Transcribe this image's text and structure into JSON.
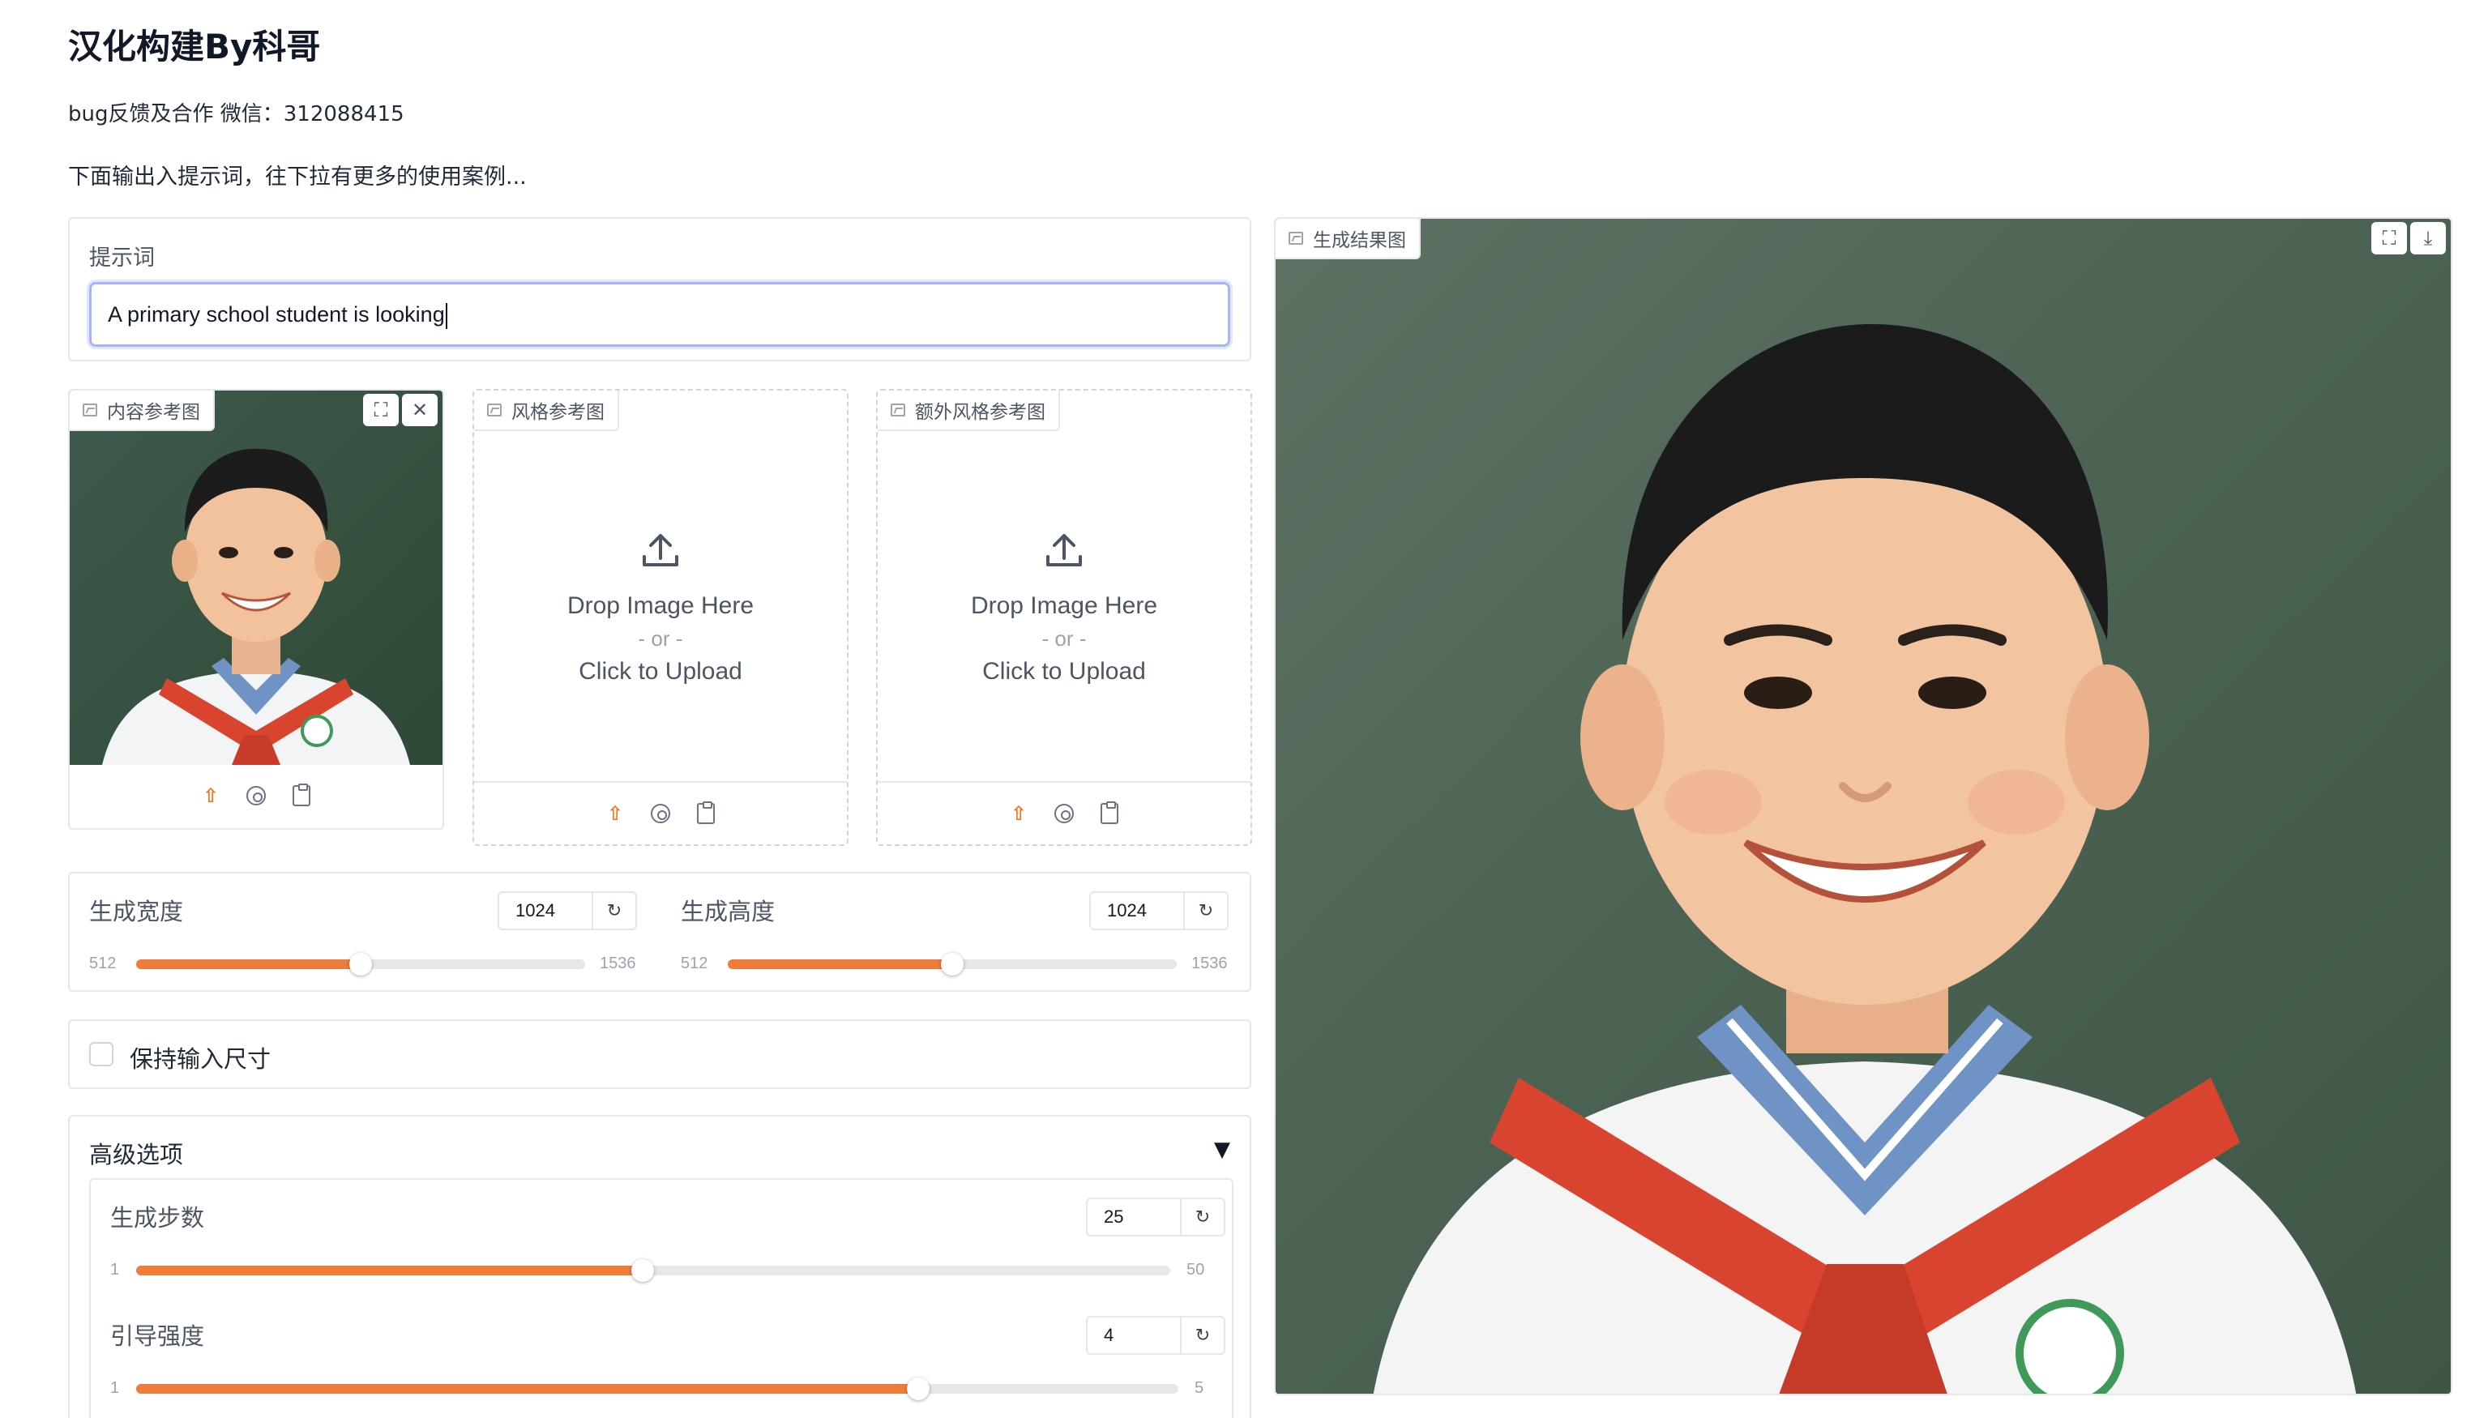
{
  "header": {
    "title": "汉化构建By科哥",
    "subtitle": "bug反馈及合作 微信：312088415",
    "hint": "下面输出入提示词，往下拉有更多的使用案例..."
  },
  "prompt": {
    "label": "提示词",
    "value": "A primary school student is looking"
  },
  "images": {
    "content": {
      "label": "内容参考图"
    },
    "style": {
      "label": "风格参考图",
      "drop": "Drop Image Here",
      "or": "- or -",
      "click": "Click to Upload"
    },
    "extra": {
      "label": "额外风格参考图",
      "drop": "Drop Image Here",
      "or": "- or -",
      "click": "Click to Upload"
    }
  },
  "size": {
    "width": {
      "label": "生成宽度",
      "value": "1024",
      "min": "512",
      "max": "1536",
      "fraction": 0.5
    },
    "height": {
      "label": "生成高度",
      "value": "1024",
      "min": "512",
      "max": "1536",
      "fraction": 0.5
    }
  },
  "keep_size": {
    "label": "保持输入尺寸",
    "checked": false
  },
  "advanced": {
    "title": "高级选项",
    "steps": {
      "label": "生成步数",
      "value": "25",
      "min": "1",
      "max": "50",
      "fraction": 0.49
    },
    "guidance": {
      "label": "引导强度",
      "value": "4",
      "min": "1",
      "max": "5",
      "fraction": 0.75
    }
  },
  "result": {
    "label": "生成结果图"
  },
  "icons": {
    "fullscreen": "⛶",
    "close": "✕",
    "download": "⤓",
    "reset": "↻",
    "upload": "⇧",
    "caret_down": "▼"
  },
  "colors": {
    "accent": "#f07c3a",
    "focus_border": "#a5b4fc"
  }
}
